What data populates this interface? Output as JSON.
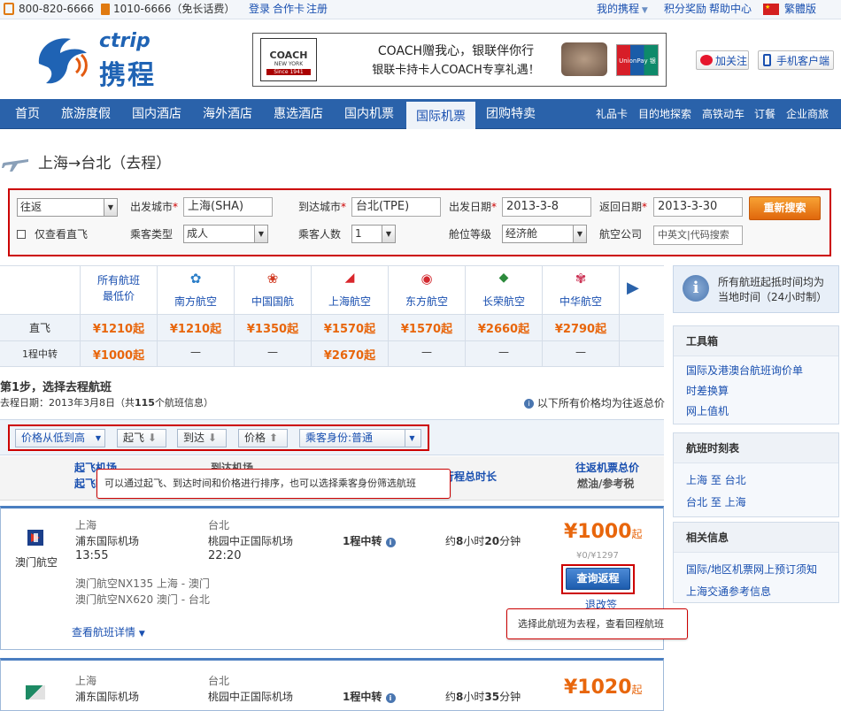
{
  "topbar": {
    "phone1": "800-820-6666",
    "phone2": "1010-6666（免长话费）",
    "login": "登录",
    "card": "合作卡",
    "register": "注册",
    "my_trip": "我的携程",
    "points": "积分奖励",
    "help": "帮助中心",
    "lang": "繁體版"
  },
  "header": {
    "logo_en": "ctrip",
    "logo_cn": "携程",
    "ad_line1": "COACH赠我心，银联伴你行",
    "ad_line2": "银联卡持卡人COACH专享礼遇！",
    "ad_brand": "COACH",
    "ad_brand_sub": "NEW YORK",
    "ad_brand_year": "Since 1941",
    "ad_bank": "UnionPay 银联",
    "follow": "加关注",
    "mobile": "手机客户端"
  },
  "nav": {
    "items": [
      "首页",
      "旅游度假",
      "国内酒店",
      "海外酒店",
      "惠选酒店",
      "国内机票",
      "国际机票",
      "团购特卖"
    ],
    "right": [
      "礼品卡",
      "目的地探索",
      "高铁动车",
      "订餐",
      "企业商旅"
    ]
  },
  "page": {
    "title": "上海→台北（去程）"
  },
  "search": {
    "trip_type": "往返",
    "from_label": "出发城市",
    "from_value": "上海(SHA)",
    "to_label": "到达城市",
    "to_value": "台北(TPE)",
    "depart_label": "出发日期",
    "depart_value": "2013-3-8",
    "return_label": "返回日期",
    "return_value": "2013-3-30",
    "research": "重新搜索",
    "direct_only": "仅查看直飞",
    "pax_type_label": "乘客类型",
    "pax_type_value": "成人",
    "pax_count_label": "乘客人数",
    "pax_count_value": "1",
    "cabin_label": "舱位等级",
    "cabin_value": "经济舱",
    "airline_label": "航空公司",
    "airline_placeholder": "中英文|代码搜索"
  },
  "matrix": {
    "corner_line1": "所有航班",
    "corner_line2": "最低价",
    "airlines": [
      "南方航空",
      "中国国航",
      "上海航空",
      "东方航空",
      "长荣航空",
      "中华航空"
    ],
    "rows": [
      {
        "label": "直飞",
        "lowest": "¥1210起",
        "cells": [
          "¥1210起",
          "¥1350起",
          "¥1570起",
          "¥1570起",
          "¥2660起",
          "¥2790起"
        ]
      },
      {
        "label": "1程中转",
        "lowest": "¥1000起",
        "cells": [
          "—",
          "—",
          "¥2670起",
          "—",
          "—",
          "—"
        ]
      }
    ]
  },
  "side": {
    "notice": "所有航班起抵时间均为当地时间（24小时制）",
    "tools_title": "工具箱",
    "tools": [
      "国际及港澳台航班询价单",
      "时差换算",
      "网上值机"
    ],
    "schedule_title": "航班时刻表",
    "schedule": [
      "上海 至 台北",
      "台北 至 上海"
    ],
    "info_title": "相关信息",
    "info": [
      "国际/地区机票网上预订须知",
      "上海交通参考信息"
    ]
  },
  "step": {
    "title": "第1步，选择去程航班",
    "date_prefix": "去程日期：2013年3月8日（共",
    "count": "115",
    "date_suffix": "个航班信息）",
    "note": "以下所有价格均为往返总价"
  },
  "sort": {
    "order": "价格从低到高",
    "depart": "起飞",
    "arrive": "到达",
    "price": "价格",
    "pax": "乘客身份:普通"
  },
  "cols": {
    "dep": "起飞机场",
    "dep2": "起飞时",
    "arr": "到达机场",
    "duration": "行程总时长",
    "total_price": "往返机票总价",
    "tax": "燃油/参考税"
  },
  "tip1": "可以通过起飞、到达时间和价格进行排序，也可以选择乘客身份筛选航班",
  "tip2": "选择此航班为去程，查看回程航班",
  "flights": [
    {
      "airline": "澳门航空",
      "dep_city": "上海",
      "dep_airport": "浦东国际机场",
      "dep_time": "13:55",
      "arr_city": "台北",
      "arr_airport": "桃园中正国际机场",
      "arr_time": "22:20",
      "stops": "1程中转",
      "duration_prefix": "约",
      "duration_h": "8",
      "duration_mid": "小时",
      "duration_m": "20",
      "duration_suffix": "分钟",
      "price": "¥1000",
      "price_suffix": "起",
      "tax": "¥0/¥1297",
      "btn": "查询返程",
      "refund": "退改签",
      "seg1": "澳门航空NX135  上海 - 澳门",
      "seg2": "澳门航空NX620  澳门 - 台北",
      "details": "查看航班详情"
    },
    {
      "dep_city": "上海",
      "dep_airport": "浦东国际机场",
      "arr_city": "台北",
      "arr_airport": "桃园中正国际机场",
      "stops": "1程中转",
      "duration_prefix": "约",
      "duration_h": "8",
      "duration_mid": "小时",
      "duration_m": "35",
      "duration_suffix": "分钟",
      "price": "¥1020",
      "price_suffix": "起"
    }
  ]
}
